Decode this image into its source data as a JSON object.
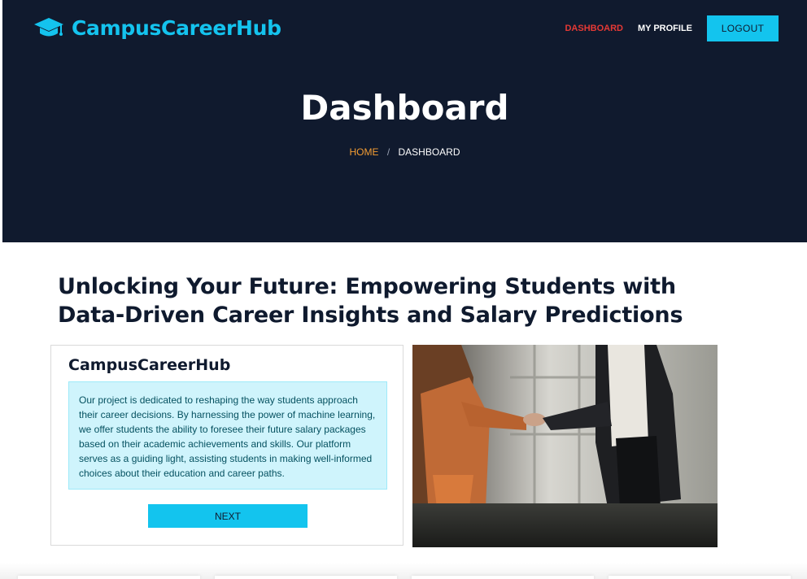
{
  "brand": {
    "name": "CampusCareerHub",
    "icon": "graduation-cap-icon",
    "color": "#14c3ee"
  },
  "nav": {
    "items": [
      {
        "label": "DASHBOARD",
        "active": true
      },
      {
        "label": "MY PROFILE",
        "active": false
      }
    ],
    "logout_label": "LOGOUT"
  },
  "hero": {
    "title": "Dashboard",
    "breadcrumb": {
      "home": "HOME",
      "separator": "/",
      "current": "DASHBOARD"
    }
  },
  "main": {
    "headline": "Unlocking Your Future: Empowering Students with Data-Driven Career Insights and Salary Predictions",
    "card": {
      "title": "CampusCareerHub",
      "description": "Our project is dedicated to reshaping the way students approach their career decisions. By harnessing the power of machine learning, we offer students the ability to foresee their future salary packages based on their academic achievements and skills. Our platform serves as a guiding light, assisting students in making well-informed choices about their education and career paths.",
      "button_label": "NEXT"
    }
  },
  "colors": {
    "hero_bg": "#101a2e",
    "accent": "#14c3ee",
    "active_nav": "#e53935",
    "breadcrumb_home": "#f39c33",
    "info_bg": "#cff4fc"
  }
}
